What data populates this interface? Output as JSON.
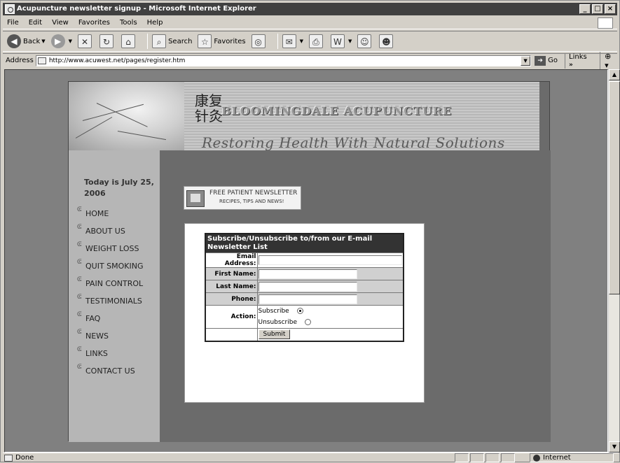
{
  "window": {
    "title": "Acupuncture newsletter signup - Microsoft Internet Explorer",
    "min": "_",
    "max": "□",
    "close": "×"
  },
  "menu": [
    "File",
    "Edit",
    "View",
    "Favorites",
    "Tools",
    "Help"
  ],
  "toolbar": {
    "back": "Back",
    "search": "Search",
    "favorites": "Favorites"
  },
  "address": {
    "label": "Address",
    "url": "http://www.acuwest.net/pages/register.htm",
    "go": "Go",
    "links": "Links"
  },
  "site": {
    "banner": {
      "chinese": "康复\n针灸",
      "name": "BLOOMINGDALE ACUPUNCTURE",
      "tagline": "Restoring Health With Natural Solutions"
    },
    "date": "Today is July 25, 2006",
    "nav": [
      "HOME",
      "ABOUT US",
      "WEIGHT LOSS",
      "QUIT SMOKING",
      "PAIN CONTROL",
      "TESTIMONIALS",
      "FAQ",
      "NEWS",
      "LINKS",
      "CONTACT US"
    ],
    "promo": {
      "line1": "FREE PATIENT NEWSLETTER",
      "line2": "RECIPES, TIPS AND NEWS!"
    },
    "form": {
      "heading": "Subscribe/Unsubscribe to/from our E-mail Newsletter List",
      "email_label": "Email Address:",
      "first_label": "First Name:",
      "last_label": "Last Name:",
      "phone_label": "Phone:",
      "action_label": "Action:",
      "opt_subscribe": "Subscribe",
      "opt_unsubscribe": "Unsubscribe",
      "selected": "Subscribe",
      "submit": "Submit"
    }
  },
  "status": {
    "text": "Done",
    "zone": "Internet"
  }
}
